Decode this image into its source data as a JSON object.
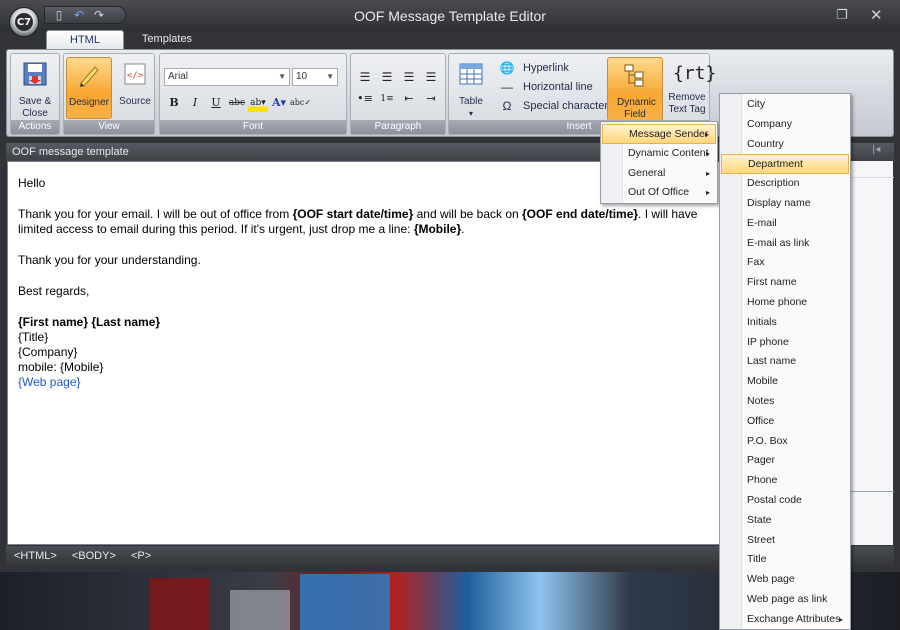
{
  "window": {
    "title": "OOF Message Template Editor"
  },
  "ribbon": {
    "tabs": [
      {
        "label": "HTML"
      },
      {
        "label": "Templates"
      }
    ],
    "groups": {
      "actions": {
        "label": "Actions",
        "save_close": "Save & Close"
      },
      "view": {
        "label": "View",
        "designer": "Designer",
        "source": "Source"
      },
      "font": {
        "label": "Font",
        "font_name": "Arial",
        "font_size": "10"
      },
      "paragraph": {
        "label": "Paragraph"
      },
      "insert": {
        "label": "Insert",
        "table": "Table",
        "hyperlink": "Hyperlink",
        "horizontal_line": "Horizontal line",
        "special_character": "Special character",
        "dynamic_field": "Dynamic Field",
        "remove_text_tag": "Remove Text Tag"
      }
    }
  },
  "pane": {
    "title": "OOF message template"
  },
  "editor": {
    "greeting": "Hello",
    "body1_a": "Thank you for your email. I will be out of office from ",
    "body1_b": "{OOF start date/time}",
    "body1_c": " and will be back on ",
    "body1_d": "{OOF end date/time}",
    "body1_e": ". I will have limited access to email during this period. If it's urgent, just drop me a line: ",
    "body1_f": "{Mobile}",
    "body1_g": ".",
    "thanks": "Thank you for your understanding.",
    "regards": "Best regards,",
    "name": "{First name} {Last name}",
    "title": "{Title}",
    "company": "{Company}",
    "mobile": "mobile: {Mobile}",
    "web": "{Web page}"
  },
  "statusbar": {
    "tags": [
      "<HTML>",
      "<BODY>",
      "<P>"
    ]
  },
  "dynamic_menu": {
    "items": [
      {
        "label": "Message Sender"
      },
      {
        "label": "Dynamic Content"
      },
      {
        "label": "General"
      },
      {
        "label": "Out Of Office"
      }
    ]
  },
  "sender_menu": {
    "items": [
      "City",
      "Company",
      "Country",
      "Department",
      "Description",
      "Display name",
      "E-mail",
      "E-mail as link",
      "Fax",
      "First name",
      "Home phone",
      "Initials",
      "IP phone",
      "Last name",
      "Mobile",
      "Notes",
      "Office",
      "P.O. Box",
      "Pager",
      "Phone",
      "Postal code",
      "State",
      "Street",
      "Title",
      "Web page",
      "Web page as link",
      "Exchange Attributes"
    ]
  }
}
